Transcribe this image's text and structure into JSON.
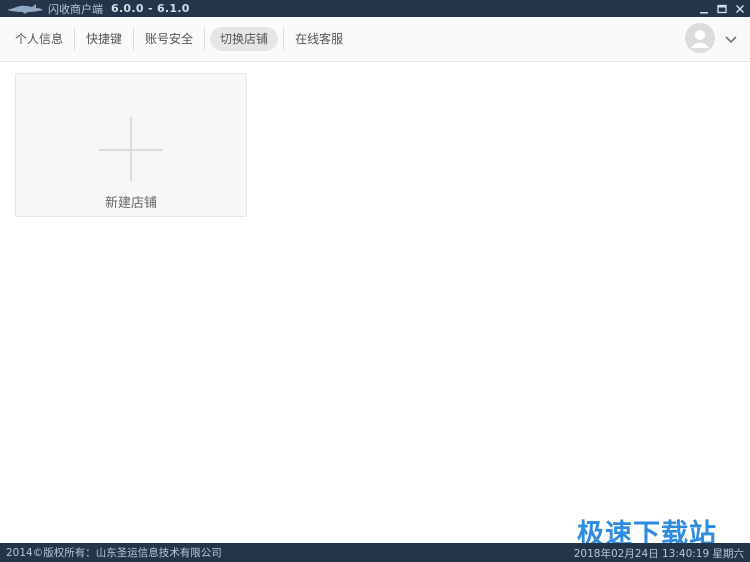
{
  "titlebar": {
    "app_name": "闪收商户端",
    "version": "6.0.0 - 6.1.0"
  },
  "menu": {
    "items": [
      {
        "label": "个人信息"
      },
      {
        "label": "快捷键"
      },
      {
        "label": "账号安全"
      },
      {
        "label": "切换店铺",
        "active": true
      },
      {
        "label": "在线客服"
      }
    ]
  },
  "store_card": {
    "label": "新建店铺"
  },
  "watermark": "极速下载站",
  "footer": {
    "copyright": "2014©版权所有：山东圣运信息技术有限公司",
    "datetime": "2018年02月24日 13:40:19 星期六"
  },
  "colors": {
    "titlebar_bg": "#243549",
    "active_tab_bg": "#e6e6e6",
    "watermark": "#2d8be0"
  },
  "icons": [
    "shark-logo-icon",
    "minimize-icon",
    "maximize-icon",
    "close-icon",
    "avatar-icon",
    "chevron-down-icon",
    "plus-icon"
  ]
}
